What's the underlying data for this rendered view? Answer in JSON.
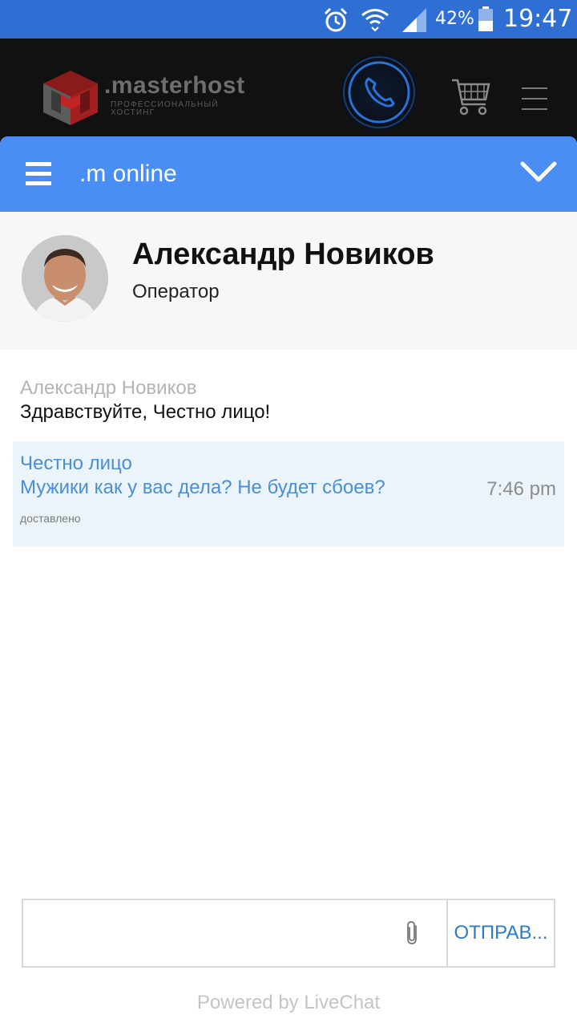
{
  "status_bar": {
    "battery": "42%",
    "time": "19:47",
    "icons": [
      "alarm-icon",
      "wifi-icon",
      "signal-icon",
      "battery-icon"
    ]
  },
  "site": {
    "logo_name": ".masterhost",
    "logo_tagline_1": "ПРОФЕССИОНАЛЬНЫЙ",
    "logo_tagline_2": "ХОСТИНГ",
    "icons": [
      "phone-icon",
      "cart-icon",
      "menu-icon"
    ]
  },
  "chat": {
    "title": ".m online",
    "accent_color": "#4a8ef3",
    "agent": {
      "name": "Александр Новиков",
      "role": "Оператор"
    },
    "messages": [
      {
        "author": "Александр Новиков",
        "text": "Здравствуйте, Честно лицо!"
      },
      {
        "author": "Честно лицо",
        "text": "Мужики как у вас дела? Не будет сбоев?",
        "time": "7:46 pm",
        "status": "доставлено"
      }
    ],
    "composer": {
      "value": "",
      "placeholder": "",
      "send_label": "ОТПРАВ..."
    },
    "powered_by": "Powered by LiveChat"
  }
}
